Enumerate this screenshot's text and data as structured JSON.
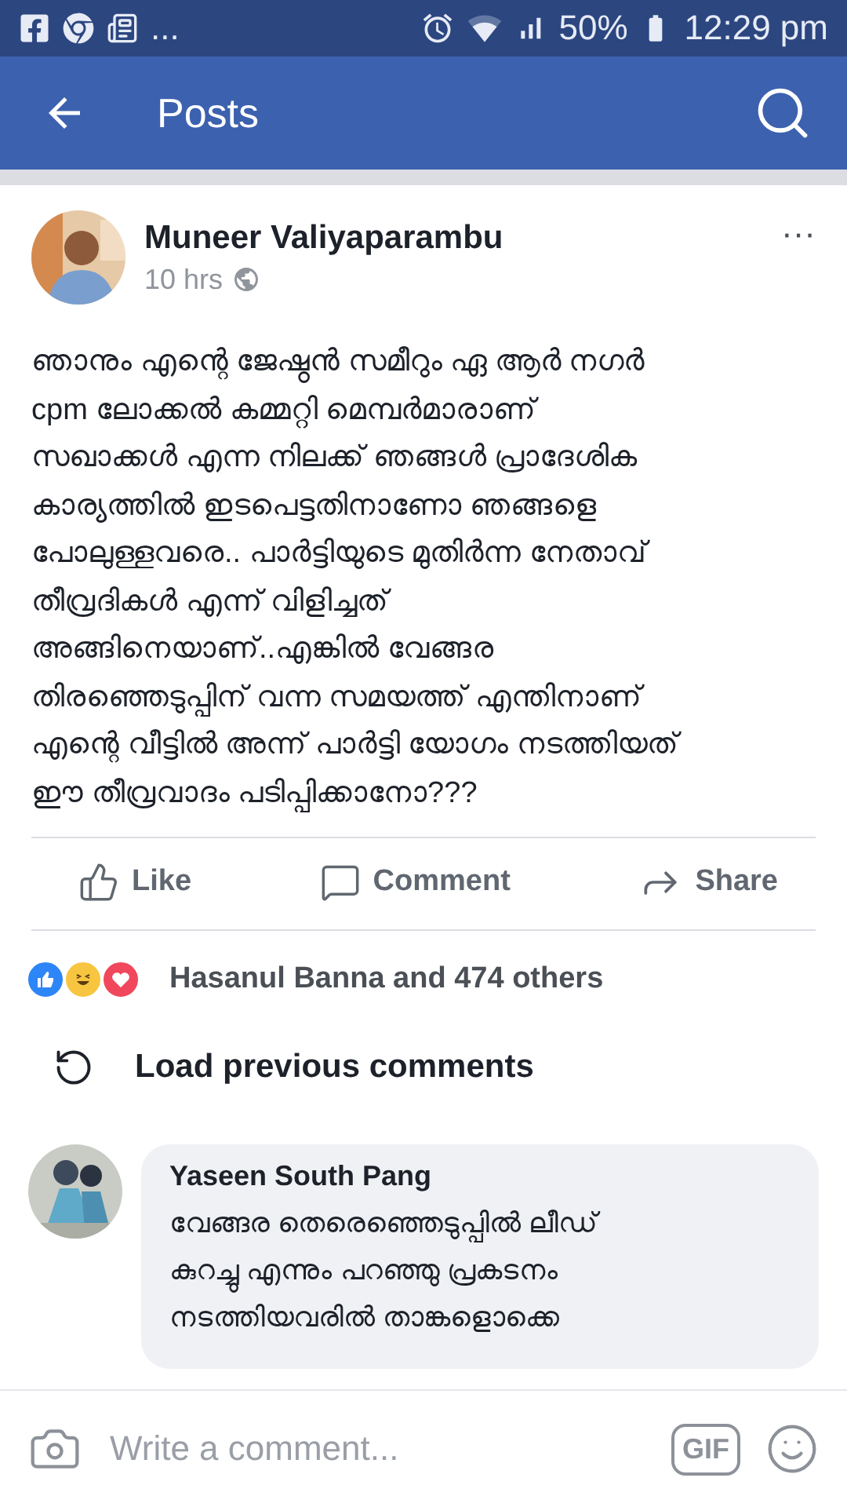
{
  "status_bar": {
    "overflow": "...",
    "battery": "50%",
    "time": "12:29 pm"
  },
  "app_bar": {
    "title": "Posts"
  },
  "post": {
    "author": "Muneer Valiyaparambu",
    "time": "10 hrs",
    "more": "···",
    "text": "ഞാനും എന്റെ ജേഷ്ഠൻ സമീറും ഏ ആർ നഗർ\ncpm ലോക്കൽ കമ്മറ്റി  മെമ്പർമാരാണ്\nസഖാക്കൾ എന്ന നിലക്ക് ഞങ്ങൾ പ്രാദേശിക\nകാര്യത്തിൽ ഇടപെട്ടതിനാണോ ഞങ്ങളെ\nപോലുള്ളവരെ.. പാർട്ടിയുടെ മുതിർന്ന നേതാവ്\nതീവ്രദികൾ എന്ന് വിളിച്ചത്\nഅങ്ങിനെയാണ്..എങ്കിൽ വേങ്ങര\nതിരഞ്ഞെടുപ്പിന് വന്ന സമയത്ത് എന്തിനാണ്\nഎന്റെ വീട്ടിൽ അന്ന് പാർട്ടി യോഗം നടത്തിയത്\nഈ തീവ്രവാദം പടിപ്പിക്കാനോ???",
    "actions": [
      {
        "kind": "like",
        "label": "Like"
      },
      {
        "kind": "comment",
        "label": "Comment"
      },
      {
        "kind": "share",
        "label": "Share"
      }
    ],
    "reactions": {
      "icons": [
        {
          "kind": "like",
          "color": "#2d86f7"
        },
        {
          "kind": "haha",
          "color": "#f7c540"
        },
        {
          "kind": "love",
          "color": "#f0475c"
        }
      ],
      "summary": "Hasanul Banna and 474 others"
    }
  },
  "load_previous": "Load previous comments",
  "comments": [
    {
      "author": "Yaseen South Pang",
      "text": "വേങ്ങര തെരെഞ്ഞെടുപ്പിൽ ലീഡ്\nകുറച്ചു എന്നും പറഞ്ഞു പ്രകടനം\nനടത്തിയവരിൽ താങ്കളൊക്കെ"
    }
  ],
  "composer": {
    "placeholder": "Write a comment...",
    "gif": "GIF"
  }
}
